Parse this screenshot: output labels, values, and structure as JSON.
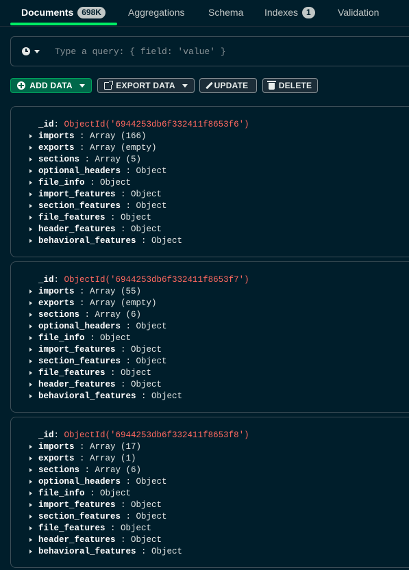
{
  "tabs": [
    {
      "label": "Documents",
      "badge": "698K"
    },
    {
      "label": "Aggregations"
    },
    {
      "label": "Schema"
    },
    {
      "label": "Indexes",
      "badge": "1"
    },
    {
      "label": "Validation"
    }
  ],
  "query": {
    "placeholder": "Type a query: { field: 'value' }",
    "value": ""
  },
  "toolbar": {
    "add_label": "ADD DATA",
    "export_label": "EXPORT DATA",
    "update_label": "UPDATE",
    "delete_label": "DELETE"
  },
  "colors": {
    "background": "#001e2b",
    "accent": "#00ed64",
    "add_button": "#00684a",
    "object_id": "#ff6960"
  },
  "documents": [
    {
      "id_key": "_id",
      "id_value": "ObjectId('6944253db6f332411f8653f6')",
      "fields": [
        {
          "key": "imports",
          "value": "Array (166)"
        },
        {
          "key": "exports",
          "value": "Array (empty)"
        },
        {
          "key": "sections",
          "value": "Array (5)"
        },
        {
          "key": "optional_headers",
          "value": "Object"
        },
        {
          "key": "file_info",
          "value": "Object"
        },
        {
          "key": "import_features",
          "value": "Object"
        },
        {
          "key": "section_features",
          "value": "Object"
        },
        {
          "key": "file_features",
          "value": "Object"
        },
        {
          "key": "header_features",
          "value": "Object"
        },
        {
          "key": "behavioral_features",
          "value": "Object"
        }
      ]
    },
    {
      "id_key": "_id",
      "id_value": "ObjectId('6944253db6f332411f8653f7')",
      "fields": [
        {
          "key": "imports",
          "value": "Array (55)"
        },
        {
          "key": "exports",
          "value": "Array (empty)"
        },
        {
          "key": "sections",
          "value": "Array (6)"
        },
        {
          "key": "optional_headers",
          "value": "Object"
        },
        {
          "key": "file_info",
          "value": "Object"
        },
        {
          "key": "import_features",
          "value": "Object"
        },
        {
          "key": "section_features",
          "value": "Object"
        },
        {
          "key": "file_features",
          "value": "Object"
        },
        {
          "key": "header_features",
          "value": "Object"
        },
        {
          "key": "behavioral_features",
          "value": "Object"
        }
      ]
    },
    {
      "id_key": "_id",
      "id_value": "ObjectId('6944253db6f332411f8653f8')",
      "fields": [
        {
          "key": "imports",
          "value": "Array (17)"
        },
        {
          "key": "exports",
          "value": "Array (1)"
        },
        {
          "key": "sections",
          "value": "Array (6)"
        },
        {
          "key": "optional_headers",
          "value": "Object"
        },
        {
          "key": "file_info",
          "value": "Object"
        },
        {
          "key": "import_features",
          "value": "Object"
        },
        {
          "key": "section_features",
          "value": "Object"
        },
        {
          "key": "file_features",
          "value": "Object"
        },
        {
          "key": "header_features",
          "value": "Object"
        },
        {
          "key": "behavioral_features",
          "value": "Object"
        }
      ]
    }
  ]
}
